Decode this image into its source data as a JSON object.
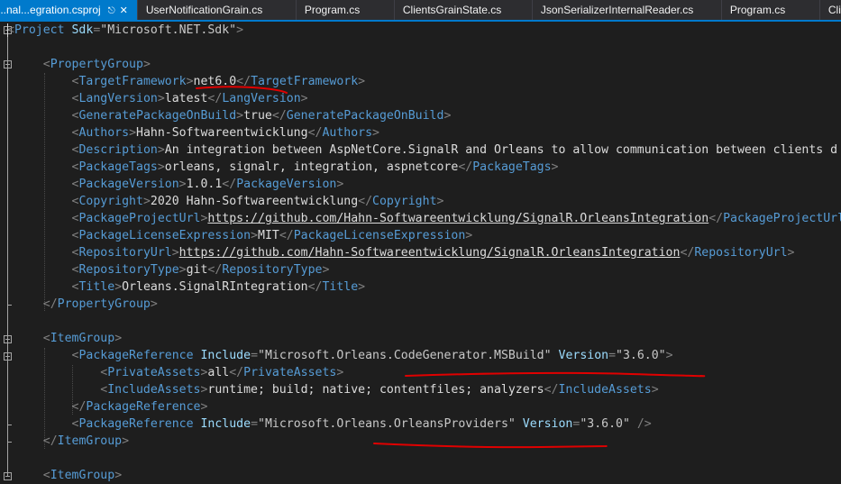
{
  "tabs": [
    {
      "label": "...nal...egration.csproj",
      "active": true
    },
    {
      "label": "UserNotificationGrain.cs",
      "active": false
    },
    {
      "label": "Program.cs",
      "active": false
    },
    {
      "label": "ClientsGrainState.cs",
      "active": false
    },
    {
      "label": "JsonSerializerInternalReader.cs",
      "active": false
    },
    {
      "label": "Program.cs",
      "active": false
    },
    {
      "label": "Clie",
      "active": false
    }
  ],
  "code": {
    "project_open": "Project",
    "project_attr": "Sdk",
    "project_attr_value": "\"Microsoft.NET.Sdk\"",
    "property_group": "PropertyGroup",
    "props": [
      {
        "tag": "TargetFramework",
        "value": "net6.0"
      },
      {
        "tag": "LangVersion",
        "value": "latest"
      },
      {
        "tag": "GeneratePackageOnBuild",
        "value": "true"
      },
      {
        "tag": "Authors",
        "value": "Hahn-Softwareentwicklung"
      },
      {
        "tag": "Description",
        "value": "An integration between AspNetCore.SignalR and Orleans to allow communication between clients d"
      },
      {
        "tag": "PackageTags",
        "value": "orleans, signalr, integration, aspnetcore"
      },
      {
        "tag": "PackageVersion",
        "value": "1.0.1"
      },
      {
        "tag": "Copyright",
        "value": "2020 Hahn-Softwareentwicklung"
      },
      {
        "tag": "PackageProjectUrl",
        "value": "https://github.com/Hahn-Softwareentwicklung/SignalR.OrleansIntegration"
      },
      {
        "tag": "PackageLicenseExpression",
        "value": "MIT"
      },
      {
        "tag": "RepositoryUrl",
        "value": "https://github.com/Hahn-Softwareentwicklung/SignalR.OrleansIntegration"
      },
      {
        "tag": "RepositoryType",
        "value": "git"
      },
      {
        "tag": "Title",
        "value": "Orleans.SignalRIntegration"
      }
    ],
    "item_group": "ItemGroup",
    "package_reference": "PackageReference",
    "include_attr": "Include",
    "version_attr": "Version",
    "ref1_include": "\"Microsoft.Orleans.CodeGenerator.MSBuild\"",
    "ref1_version": "\"3.6.0\"",
    "private_assets_tag": "PrivateAssets",
    "private_assets_value": "all",
    "include_assets_tag": "IncludeAssets",
    "include_assets_value": "runtime; build; native; contentfiles; analyzers",
    "ref2_include": "\"Microsoft.Orleans.OrleansProviders\"",
    "ref2_version": "\"3.6.0\""
  },
  "colors": {
    "editor_bg": "#1e1e1e",
    "tag": "#569cd6",
    "attribute": "#9cdcfe",
    "punctuation": "#808080",
    "text": "#dcdcdc",
    "active_tab": "#007acc",
    "annotation": "#e00000"
  }
}
